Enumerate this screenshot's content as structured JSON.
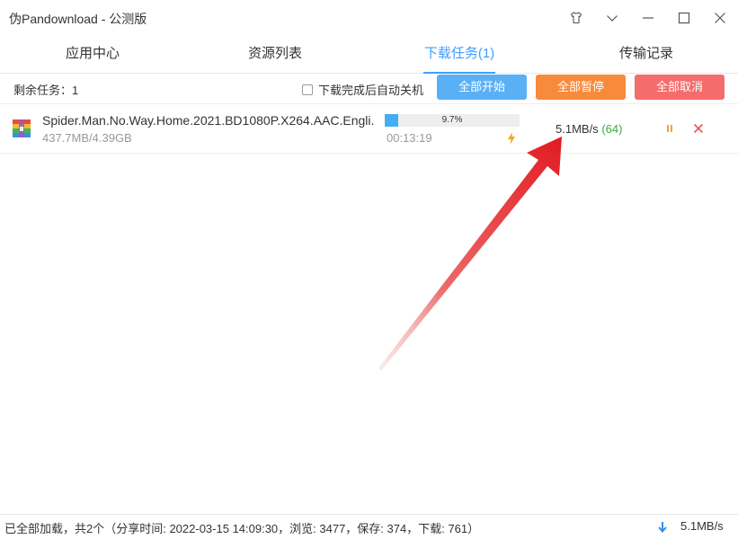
{
  "window": {
    "title": "伪Pandownload - 公测版",
    "buttons": [
      "shirt-icon",
      "chevron-down-icon",
      "minimize-icon",
      "maximize-icon",
      "close-icon"
    ]
  },
  "tabs": [
    {
      "label": "应用中心",
      "active": false
    },
    {
      "label": "资源列表",
      "active": false
    },
    {
      "label": "下载任务(1)",
      "active": true
    },
    {
      "label": "传输记录",
      "active": false
    }
  ],
  "toolbar": {
    "remaining_label": "剩余任务：",
    "remaining_count": "1",
    "auto_shutdown_label": "下载完成后自动关机",
    "auto_shutdown_checked": false,
    "start_all": "全部开始",
    "pause_all": "全部暂停",
    "cancel_all": "全部取消"
  },
  "download": {
    "file_name": "Spider.Man.No.Way.Home.2021.BD1080P.X264.AAC.Engli...",
    "size": "437.7MB/4.39GB",
    "progress_text": "9.7%",
    "progress_value": 0.097,
    "elapsed": "00:13:19",
    "speed": "5.1MB/s",
    "connections": "(64)"
  },
  "status": {
    "text": "已全部加载，共2个（分享时间: 2022-03-15 14:09:30，浏览: 3477，保存: 374，下载: 761）",
    "total_speed": "5.1MB/s"
  },
  "colors": {
    "accent": "#409eff",
    "start": "#5ab0f5",
    "pause": "#f88a3c",
    "cancel": "#f46c6c",
    "annotation_arrow": "#e8202a"
  }
}
